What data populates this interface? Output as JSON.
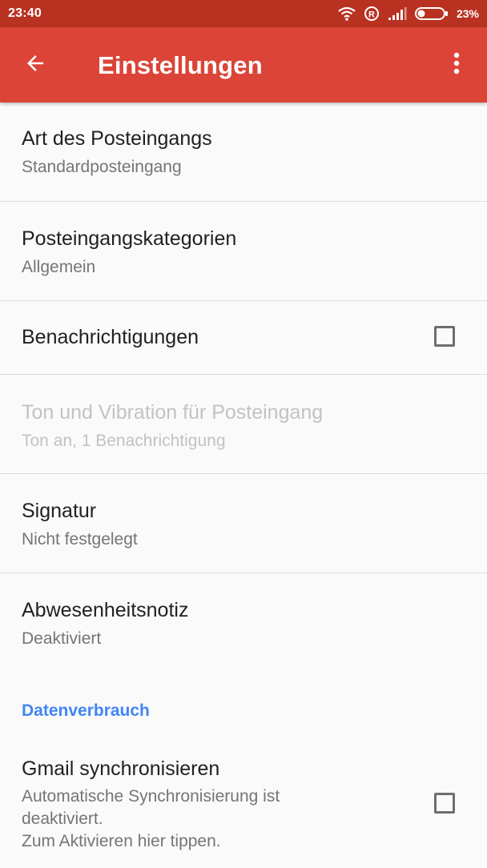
{
  "status_bar": {
    "time": "23:40",
    "battery_percent": "23%",
    "battery_level": 0.23,
    "icons": [
      "wifi-icon",
      "registered-icon",
      "signal-icon",
      "battery-icon"
    ]
  },
  "app_bar": {
    "title": "Einstellungen",
    "back_icon": "arrow-back-icon",
    "menu_icon": "more-vert-icon",
    "color": "#db4437"
  },
  "settings": {
    "inbox_type": {
      "title": "Art des Posteingangs",
      "summary": "Standardposteingang"
    },
    "inbox_categories": {
      "title": "Posteingangskategorien",
      "summary": "Allgemein"
    },
    "notifications": {
      "title": "Benachrichtigungen",
      "checked": false
    },
    "sound_vibration": {
      "title": "Ton und Vibration für Posteingang",
      "summary": "Ton an, 1 Benachrichtigung",
      "enabled": false
    },
    "signature": {
      "title": "Signatur",
      "summary": "Nicht festgelegt"
    },
    "vacation_responder": {
      "title": "Abwesenheitsnotiz",
      "summary": "Deaktiviert"
    }
  },
  "data_usage": {
    "header": "Datenverbrauch",
    "header_color": "#4285f4",
    "sync_gmail": {
      "title": "Gmail synchronisieren",
      "summary": "Automatische Synchronisierung ist\ndeaktiviert.\nZum Aktivieren hier tippen.",
      "checked": false
    }
  }
}
